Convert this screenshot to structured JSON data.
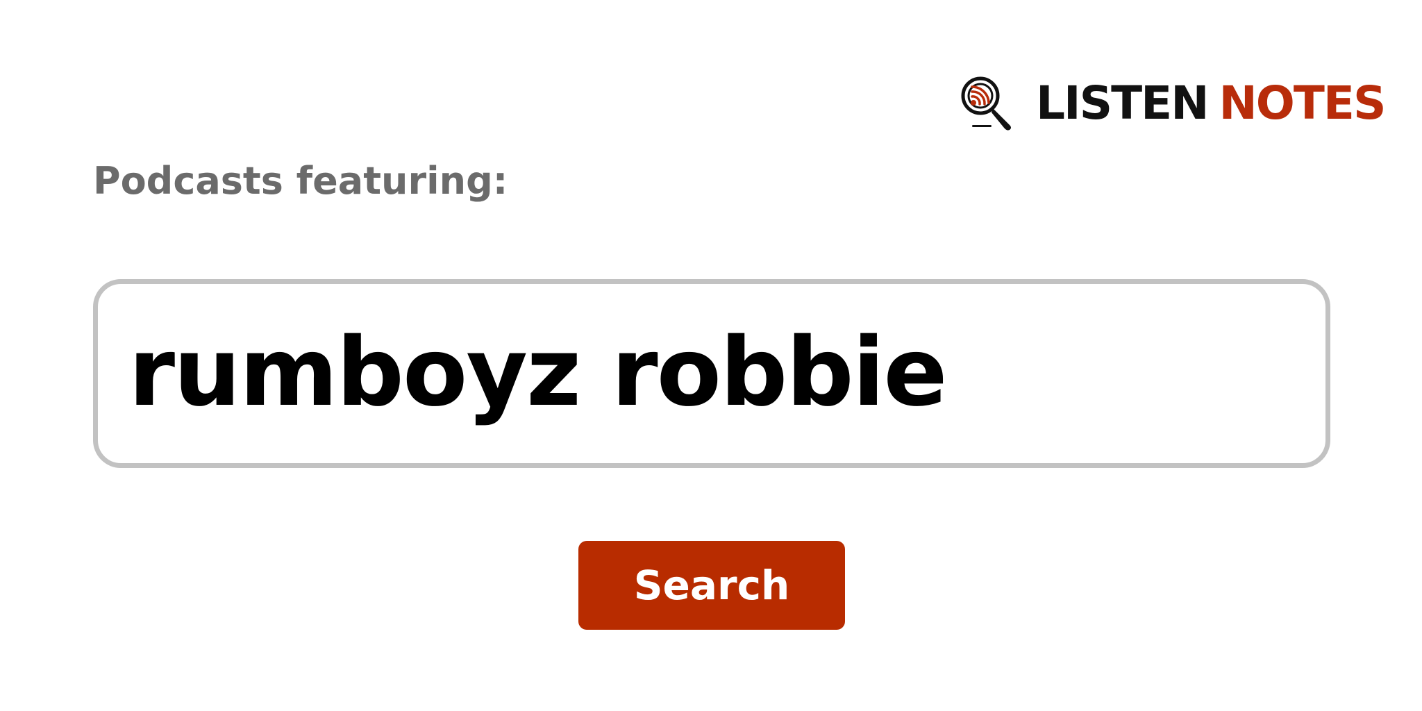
{
  "brand": {
    "word1": "LISTEN",
    "word2": "NOTES",
    "colors": {
      "dark": "#111111",
      "accent": "#b82c0a"
    },
    "icon": "magnifier-podcast-icon"
  },
  "label": "Podcasts featuring:",
  "search": {
    "value": "rumboyz robbie"
  },
  "button": {
    "label": "Search",
    "color": "#b82c00"
  }
}
